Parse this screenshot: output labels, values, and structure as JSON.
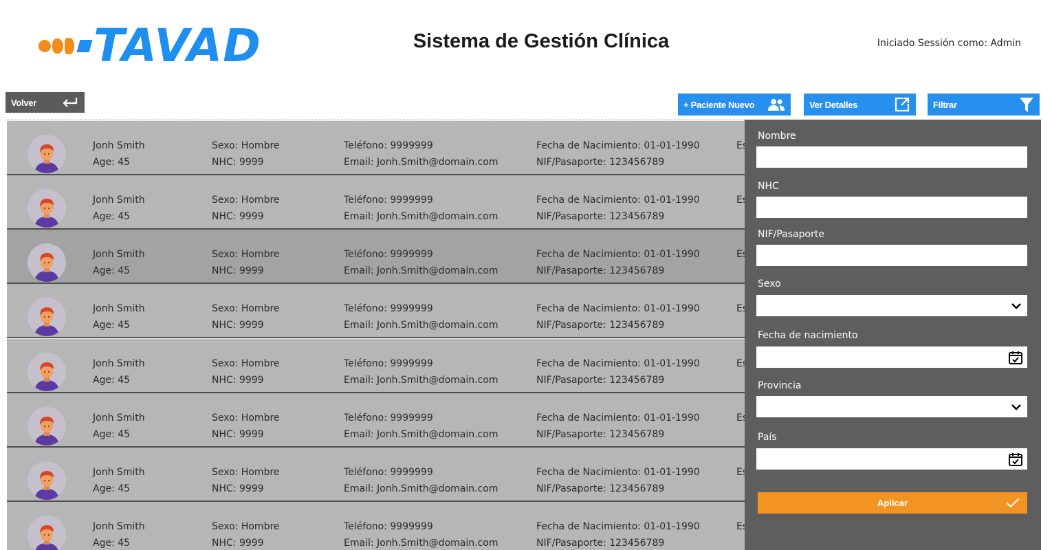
{
  "header": {
    "logo_text": "TAVAD",
    "title": "Sistema de Gestión Clínica",
    "session": "Iniciado Sessión como: Admin"
  },
  "toolbar": {
    "back_label": "Volver",
    "new_patient_label": "+ Paciente Nuevo",
    "details_label": "Ver Detalles",
    "filter_label": "Filtrar"
  },
  "patients": [
    {
      "name": "Jonh Smith",
      "age": "Age: 45",
      "sex": "Sexo: Hombre",
      "nhc": "NHC: 9999",
      "phone": "Teléfono: 9999999",
      "email": "Email: Jonh.Smith@domain.com",
      "birth": "Fecha de Nacimiento: 01-01-1990",
      "nif": "NIF/Pasaporte: 123456789",
      "extra": "Es"
    },
    {
      "name": "Jonh Smith",
      "age": "Age: 45",
      "sex": "Sexo: Hombre",
      "nhc": "NHC: 9999",
      "phone": "Teléfono: 9999999",
      "email": "Email: Jonh.Smith@domain.com",
      "birth": "Fecha de Nacimiento: 01-01-1990",
      "nif": "NIF/Pasaporte: 123456789",
      "extra": "Es"
    },
    {
      "name": "Jonh Smith",
      "age": "Age: 45",
      "sex": "Sexo: Hombre",
      "nhc": "NHC: 9999",
      "phone": "Teléfono: 9999999",
      "email": "Email: Jonh.Smith@domain.com",
      "birth": "Fecha de Nacimiento: 01-01-1990",
      "nif": "NIF/Pasaporte: 123456789",
      "extra": "Es"
    },
    {
      "name": "Jonh Smith",
      "age": "Age: 45",
      "sex": "Sexo: Hombre",
      "nhc": "NHC: 9999",
      "phone": "Teléfono: 9999999",
      "email": "Email: Jonh.Smith@domain.com",
      "birth": "Fecha de Nacimiento: 01-01-1990",
      "nif": "NIF/Pasaporte: 123456789",
      "extra": "Es"
    },
    {
      "name": "Jonh Smith",
      "age": "Age: 45",
      "sex": "Sexo: Hombre",
      "nhc": "NHC: 9999",
      "phone": "Teléfono: 9999999",
      "email": "Email: Jonh.Smith@domain.com",
      "birth": "Fecha de Nacimiento: 01-01-1990",
      "nif": "NIF/Pasaporte: 123456789",
      "extra": "Es"
    },
    {
      "name": "Jonh Smith",
      "age": "Age: 45",
      "sex": "Sexo: Hombre",
      "nhc": "NHC: 9999",
      "phone": "Teléfono: 9999999",
      "email": "Email: Jonh.Smith@domain.com",
      "birth": "Fecha de Nacimiento: 01-01-1990",
      "nif": "NIF/Pasaporte: 123456789",
      "extra": "Es"
    },
    {
      "name": "Jonh Smith",
      "age": "Age: 45",
      "sex": "Sexo: Hombre",
      "nhc": "NHC: 9999",
      "phone": "Teléfono: 9999999",
      "email": "Email: Jonh.Smith@domain.com",
      "birth": "Fecha de Nacimiento: 01-01-1990",
      "nif": "NIF/Pasaporte: 123456789",
      "extra": "Es"
    },
    {
      "name": "Jonh Smith",
      "age": "Age: 45",
      "sex": "Sexo: Hombre",
      "nhc": "NHC: 9999",
      "phone": "Teléfono: 9999999",
      "email": "Email: Jonh.Smith@domain.com",
      "birth": "Fecha de Nacimiento: 01-01-1990",
      "nif": "NIF/Pasaporte: 123456789",
      "extra": "Es"
    }
  ],
  "filter": {
    "nombre_label": "Nombre",
    "nombre_value": "",
    "nhc_label": "NHC",
    "nhc_value": "",
    "nif_label": "NIF/Pasaporte",
    "nif_value": "",
    "sexo_label": "Sexo",
    "sexo_value": "",
    "fecha_label": "Fecha de nacimiento",
    "fecha_value": "",
    "provincia_label": "Provincia",
    "provincia_value": "",
    "pais_label": "País",
    "pais_value": "",
    "apply_label": "Aplicar"
  },
  "colors": {
    "accent_blue": "#2790ee",
    "apply_orange": "#f39422",
    "panel_gray": "#5e5e5e",
    "row_gray": "#b6b6b6",
    "row_selected": "#a3a3a3"
  },
  "icons": {
    "back": "return-arrow-icon",
    "new_patient": "people-icon",
    "details": "open-external-icon",
    "filter": "funnel-icon",
    "select": "chevron-down-icon",
    "date": "calendar-check-icon",
    "apply": "check-icon"
  }
}
